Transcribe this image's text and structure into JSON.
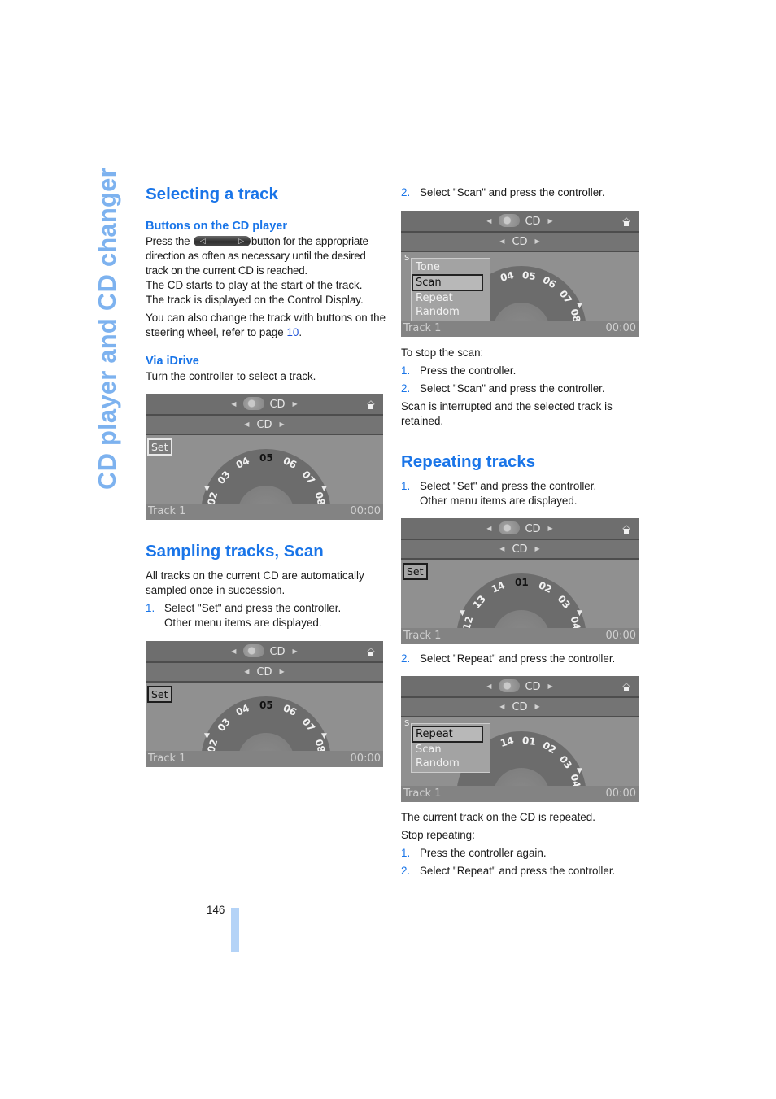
{
  "chapter_title": "CD player and CD changer",
  "page_number": "146",
  "left": {
    "h_selecting": "Selecting a track",
    "h_buttons": "Buttons on the CD player",
    "p1_before": "Press the",
    "p1_after": "button for the appropriate direction as often as necessary until the desired track on the current CD is reached.",
    "p2": "The CD starts to play at the start of the track.",
    "p3": "The track is displayed on the Control Display.",
    "p4_before": "You can also change the track with buttons on the steering wheel, refer to page",
    "p4_link": "10",
    "p4_after": ".",
    "h_idrive": "Via iDrive",
    "p5": "Turn the controller to select a track.",
    "h_sampling": "Sampling tracks, Scan",
    "p6": "All tracks on the current CD are automatically sampled once in succession.",
    "step1_num": "1.",
    "step1": "Select \"Set\" and press the controller.",
    "step1_sub": "Other menu items are displayed."
  },
  "right": {
    "step2_num": "2.",
    "step2": "Select \"Scan\" and press the controller.",
    "stop_scan": "To stop the scan:",
    "stop1_num": "1.",
    "stop1": "Press the controller.",
    "stop2_num": "2.",
    "stop2": "Select \"Scan\" and press the controller.",
    "scan_note": "Scan is interrupted and the selected track is retained.",
    "h_repeat": "Repeating tracks",
    "r1_num": "1.",
    "r1": "Select \"Set\" and press the controller.",
    "r1_sub": "Other menu items are displayed.",
    "r2_num": "2.",
    "r2": "Select \"Repeat\" and press the controller.",
    "repeat_note": "The current track on the CD is repeated.",
    "stop_repeat": "Stop repeating:",
    "sr1_num": "1.",
    "sr1": "Press the controller again.",
    "sr2_num": "2.",
    "sr2": "Select \"Repeat\" and press the controller."
  },
  "screens": {
    "top_label": "CD",
    "sub_label": "CD",
    "set_label": "Set",
    "status_left": "Track 1",
    "status_right": "00:00",
    "select": {
      "tracks": [
        "02",
        "03",
        "04",
        "05",
        "06",
        "07",
        "08"
      ],
      "current": "05"
    },
    "scan_set": {
      "tracks": [
        "02",
        "03",
        "04",
        "05",
        "06",
        "07",
        "08"
      ],
      "current": "05"
    },
    "scan_menu": {
      "tracks": [
        "04",
        "05",
        "06",
        "07",
        "08"
      ],
      "menu": [
        "Tone",
        "Scan",
        "Repeat",
        "Random"
      ],
      "selected": "Scan"
    },
    "repeat_set": {
      "tracks": [
        "12",
        "13",
        "14",
        "01",
        "02",
        "03",
        "04"
      ],
      "current": "01"
    },
    "repeat_menu": {
      "tracks": [
        "14",
        "01",
        "02",
        "03",
        "04"
      ],
      "menu": [
        "Repeat",
        "Scan",
        "Random"
      ],
      "selected": "Repeat"
    }
  }
}
